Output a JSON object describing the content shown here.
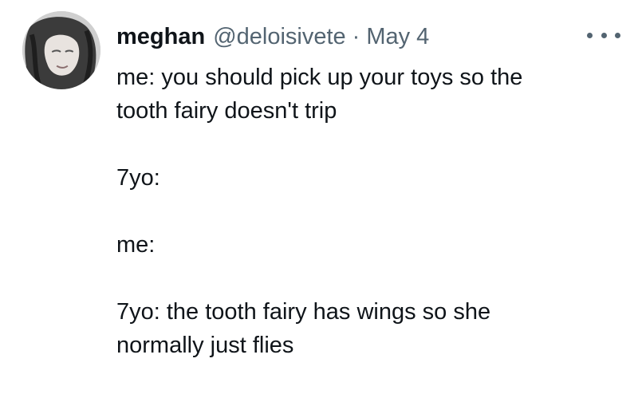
{
  "tweet": {
    "display_name": "meghan",
    "handle": "@deloisivete",
    "separator": "·",
    "date": "May 4",
    "body": {
      "line1": "me: you should pick up your toys so the",
      "line2": "tooth fairy doesn't trip",
      "line3": "7yo:",
      "line4": "me:",
      "line5": "7yo: the tooth fairy has wings so she",
      "line6": "normally just flies"
    }
  },
  "icons": {
    "avatar": "avatar-photo",
    "more": "more-options-icon"
  }
}
